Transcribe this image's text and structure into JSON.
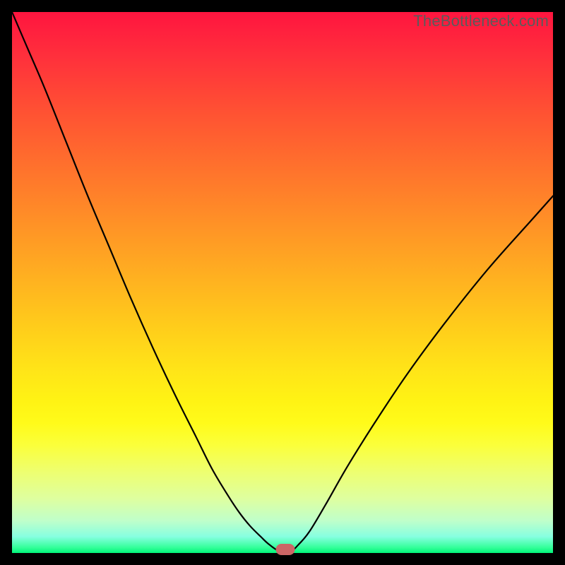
{
  "watermark": "TheBottleneck.com",
  "chart_data": {
    "type": "line",
    "title": "",
    "xlabel": "",
    "ylabel": "",
    "xlim": [
      0,
      100
    ],
    "ylim": [
      0,
      100
    ],
    "grid": false,
    "legend": false,
    "series": [
      {
        "name": "bottleneck-curve",
        "x_pct": [
          0,
          3,
          6,
          10,
          14,
          18,
          22,
          26,
          30,
          34,
          37,
          40,
          42,
          44,
          46,
          47.5,
          49.5,
          51.5,
          53,
          55,
          58,
          62,
          67,
          73,
          80,
          88,
          96,
          100
        ],
        "y_pct": [
          100,
          93,
          86,
          76,
          66,
          56.5,
          47,
          38,
          29.5,
          21.5,
          15.5,
          10.5,
          7.5,
          5,
          3,
          1.6,
          0.3,
          0.3,
          1.6,
          4,
          9,
          16,
          24,
          33,
          42.5,
          52.5,
          61.5,
          66
        ]
      }
    ],
    "marker": {
      "x_pct": 50.5,
      "y_pct": 0
    },
    "background_gradient": {
      "top": "#ff153f",
      "mid": "#ffe418",
      "bottom": "#00f57a"
    }
  }
}
